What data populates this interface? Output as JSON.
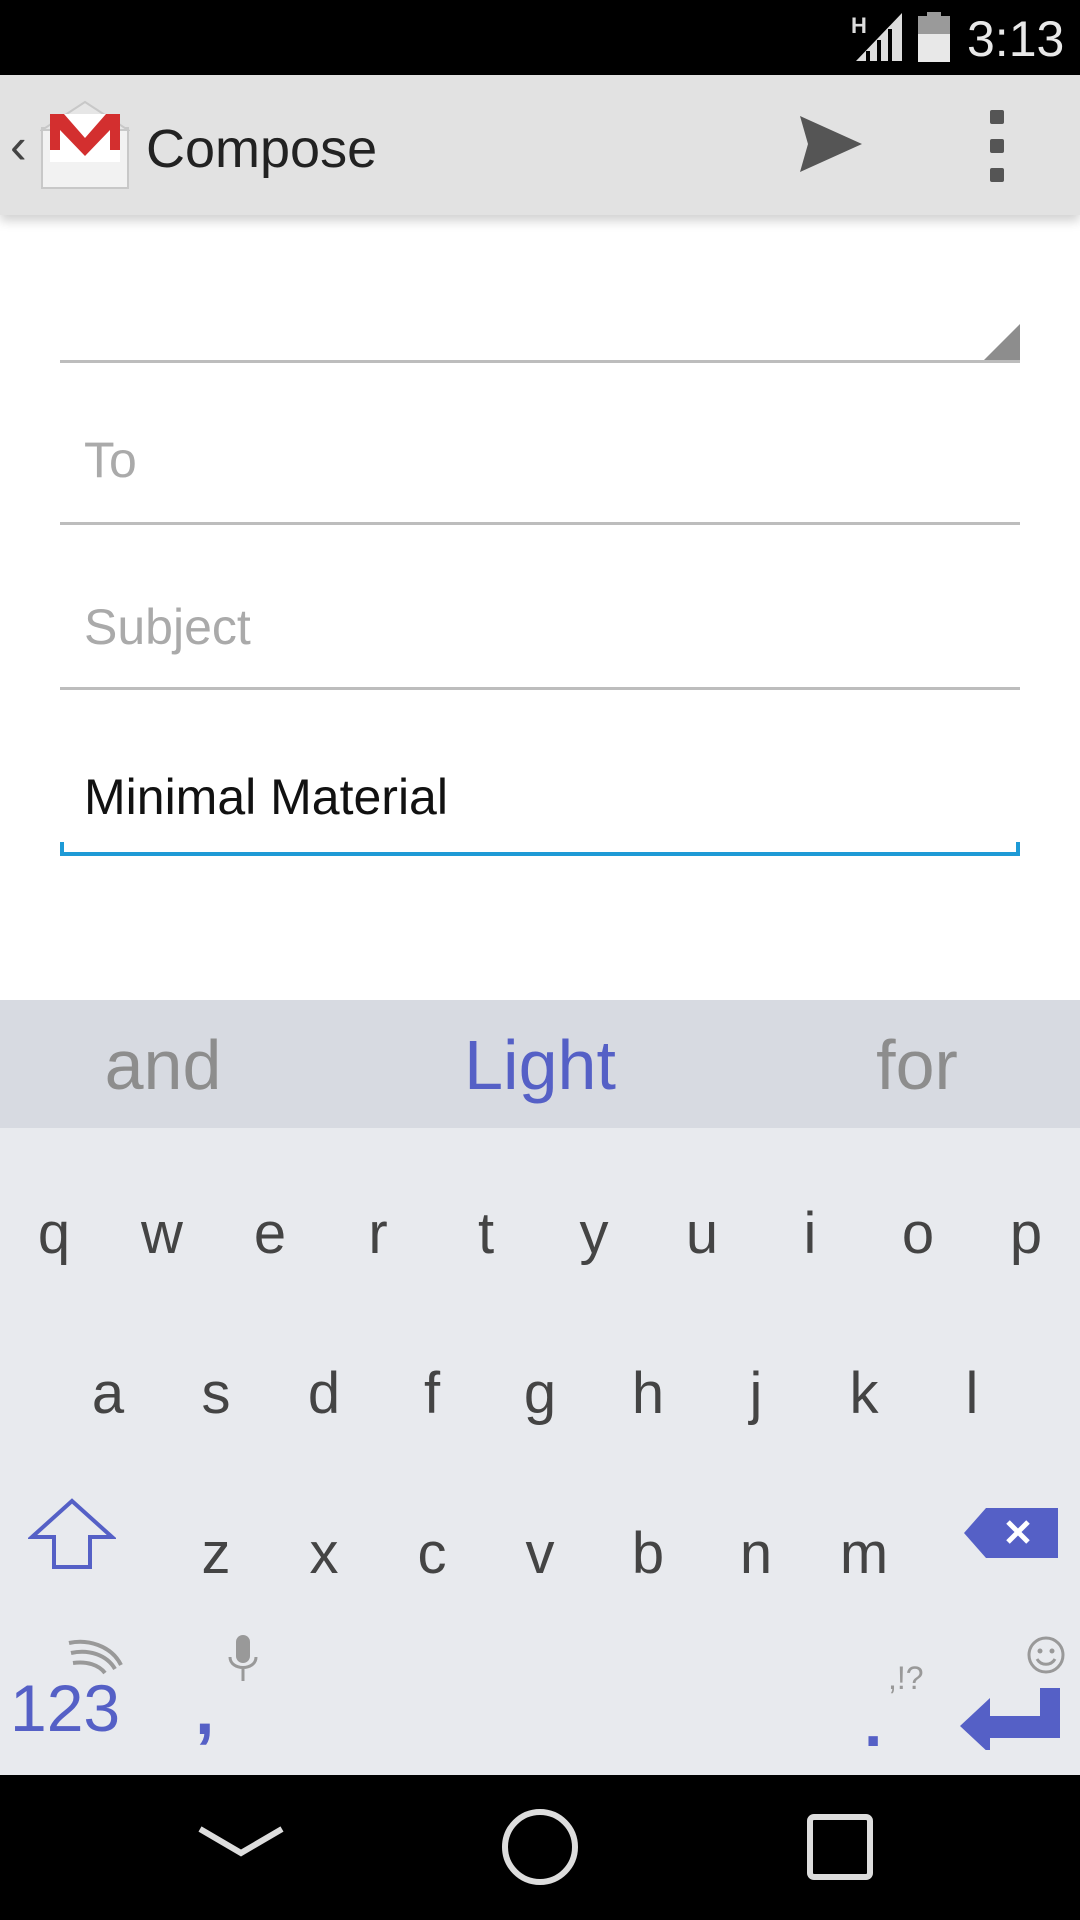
{
  "status_bar": {
    "network": "H",
    "time": "3:13"
  },
  "action_bar": {
    "title": "Compose",
    "icons": {
      "up": "chevron-left-icon",
      "app": "gmail-logo",
      "send": "send-icon",
      "overflow": "overflow-menu-icon"
    }
  },
  "compose": {
    "from_value": "",
    "to_placeholder": "To",
    "subject_placeholder": "Subject",
    "body_value": "Minimal Material"
  },
  "keyboard": {
    "suggestions": [
      "and",
      "Light",
      "for"
    ],
    "row1": [
      "q",
      "w",
      "e",
      "r",
      "t",
      "y",
      "u",
      "i",
      "o",
      "p"
    ],
    "row2": [
      "a",
      "s",
      "d",
      "f",
      "g",
      "h",
      "j",
      "k",
      "l"
    ],
    "row3": [
      "z",
      "x",
      "c",
      "v",
      "b",
      "n",
      "m"
    ],
    "numbers_label": "123",
    "comma_label": ",",
    "period_label": ".",
    "punct_hint": ",!?",
    "accent_color": "#5560c6"
  },
  "colors": {
    "action_bar": "#e2e2e2",
    "active_underline": "#1e9ad6",
    "keyboard_bg": "#e8eaee",
    "suggestion_bg": "#d7dae1"
  }
}
